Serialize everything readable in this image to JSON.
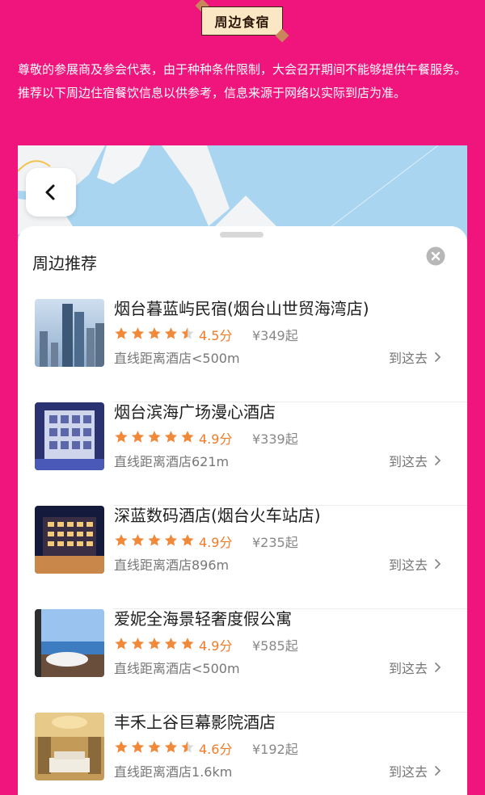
{
  "header": {
    "title": "周边食宿"
  },
  "intro": {
    "text": "尊敬的参展商及参会代表，由于种种条件限制，大会召开期间不能够提供午餐服务。推荐以下周边住宿餐饮信息以供参考，信息来源于网络以实际到店为准。"
  },
  "colors": {
    "background": "#f0147d",
    "badge": "#fbe7c4",
    "star": "#f08a3a",
    "score": "#f07c28"
  },
  "sheet": {
    "title": "周边推荐",
    "goto_label": "到这去"
  },
  "hotels": [
    {
      "name": "烟台暮蓝屿民宿(烟台山世贸海湾店)",
      "rating": 4.5,
      "score_text": "4.5分",
      "price": "¥349起",
      "distance": "直线距离酒店<500m",
      "thumb": "city-tower"
    },
    {
      "name": "烟台滨海广场漫心酒店",
      "rating": 4.9,
      "score_text": "4.9分",
      "price": "¥339起",
      "distance": "直线距离酒店621m",
      "thumb": "blue-facade"
    },
    {
      "name": "深蓝数码酒店(烟台火车站店)",
      "rating": 4.9,
      "score_text": "4.9分",
      "price": "¥235起",
      "distance": "直线距离酒店896m",
      "thumb": "night-building"
    },
    {
      "name": "爱妮全海景轻奢度假公寓",
      "rating": 4.9,
      "score_text": "4.9分",
      "price": "¥585起",
      "distance": "直线距离酒店<500m",
      "thumb": "sea-view-bathtub"
    },
    {
      "name": "丰禾上谷巨幕影院酒店",
      "rating": 4.6,
      "score_text": "4.6分",
      "price": "¥192起",
      "distance": "直线距离酒店1.6km",
      "thumb": "golden-room"
    }
  ]
}
